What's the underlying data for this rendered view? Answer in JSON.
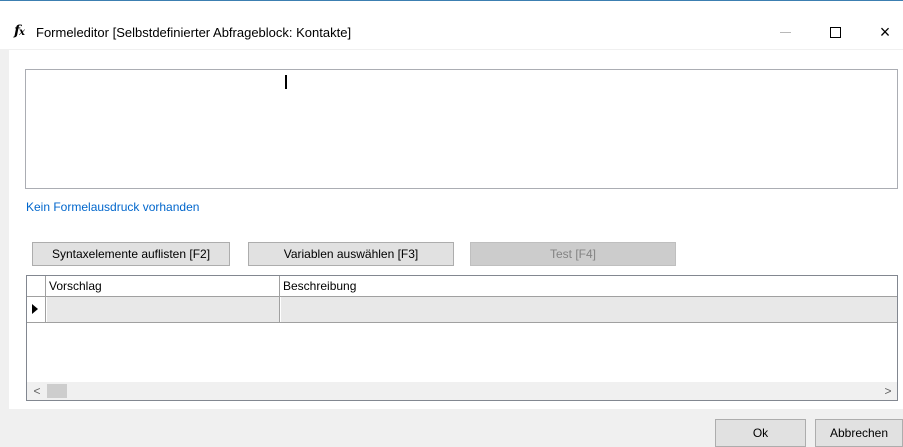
{
  "window": {
    "title": "Formeleditor [Selbstdefinierter Abfrageblock: Kontakte]",
    "icon": "fx-formula-icon",
    "icon_glyph_f": "f",
    "icon_glyph_x": "x",
    "controls": {
      "minimize": "minimize-icon",
      "maximize": "maximize-icon",
      "close": "×"
    }
  },
  "editor": {
    "value": ""
  },
  "status": {
    "message": "Kein Formelausdruck vorhanden"
  },
  "toolbar": {
    "syntax_label": "Syntaxelemente auflisten [F2]",
    "variables_label": "Variablen auswählen [F3]",
    "test_label": "Test [F4]"
  },
  "grid": {
    "columns": [
      "Vorschlag",
      "Beschreibung"
    ],
    "rows": [
      {
        "vorschlag": "",
        "beschreibung": ""
      }
    ],
    "scroll_left": "<",
    "scroll_right": ">"
  },
  "footer": {
    "ok_label": "Ok",
    "cancel_label": "Abbrechen"
  },
  "colors": {
    "status_link": "#0066cc",
    "disabled_button": "#cccccc",
    "button": "#e1e1e1"
  }
}
